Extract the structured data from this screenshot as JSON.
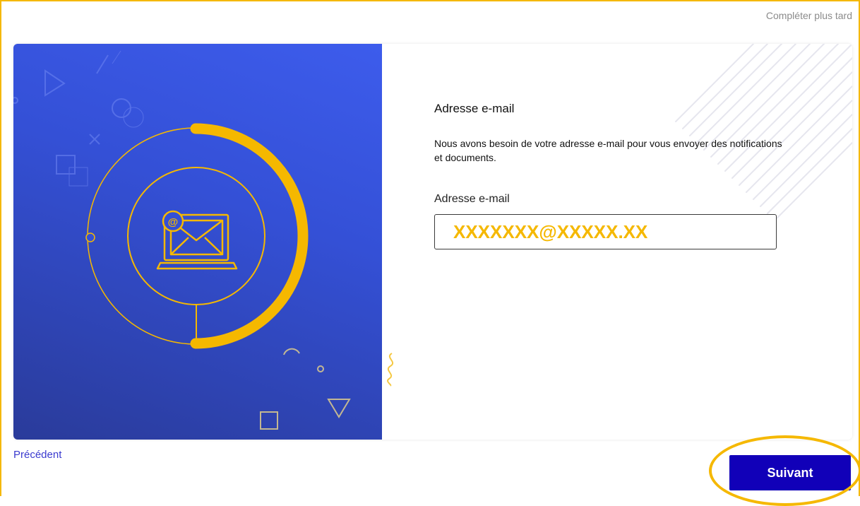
{
  "header": {
    "complete_later_label": "Compléter plus tard"
  },
  "illustration": {
    "icon": "envelope-on-laptop-icon",
    "at_symbol": "@"
  },
  "form": {
    "section_title": "Adresse e-mail",
    "description": "Nous avons besoin de votre adresse e-mail pour vous envoyer des notifications et documents.",
    "email_label": "Adresse e-mail",
    "email_value": "XXXXXXX@XXXXX.XX"
  },
  "footer": {
    "previous_label": "Précédent",
    "next_label": "Suivant"
  },
  "colors": {
    "accent_yellow": "#f5b800",
    "panel_blue": "#3450d6",
    "button_blue": "#1100b8",
    "link_blue": "#3a3acf"
  }
}
